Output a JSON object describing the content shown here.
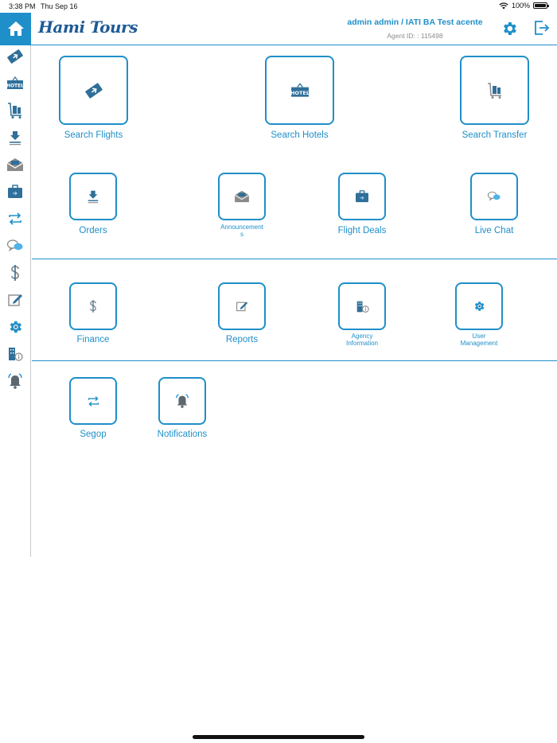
{
  "status_bar": {
    "time": "3:38 PM",
    "date": "Thu Sep 16",
    "battery": "100%",
    "battery_level": 1.0
  },
  "header": {
    "logo": "Hami Tours",
    "user": "admin admin / IATI BA Test acente",
    "agent_id": "Agent ID: : 115498"
  },
  "colors": {
    "accent": "#1f8fc9",
    "logo": "#1e5a96",
    "icon_dark": "#2f6f99",
    "icon_gray": "#8a8a8a",
    "divider": "#1f8fc9"
  },
  "sidebar": {
    "items": [
      {
        "icon": "flight-ticket-icon"
      },
      {
        "icon": "hotel-icon"
      },
      {
        "icon": "luggage-cart-icon"
      },
      {
        "icon": "download-tray-icon"
      },
      {
        "icon": "envelope-icon"
      },
      {
        "icon": "briefcase-icon"
      },
      {
        "icon": "exchange-arrows-icon"
      },
      {
        "icon": "chat-bubbles-icon"
      },
      {
        "icon": "dollar-icon"
      },
      {
        "icon": "edit-note-icon"
      },
      {
        "icon": "gear-icon"
      },
      {
        "icon": "building-info-icon"
      },
      {
        "icon": "bell-icon"
      }
    ]
  },
  "tiles": {
    "search_flights": "Search Flights",
    "search_hotels": "Search Hotels",
    "search_transfer": "Search Transfer",
    "orders": "Orders",
    "announcements_1": "Announcement",
    "announcements_2": "s",
    "flight_deals": "Flight Deals",
    "live_chat": "Live Chat",
    "finance": "Finance",
    "reports": "Reports",
    "agency_info_1": "Agency",
    "agency_info_2": "Information",
    "user_mgmt_1": "User",
    "user_mgmt_2": "Management",
    "segop": "Segop",
    "notifications": "Notifications",
    "hotel_sign": "HOTEL"
  }
}
